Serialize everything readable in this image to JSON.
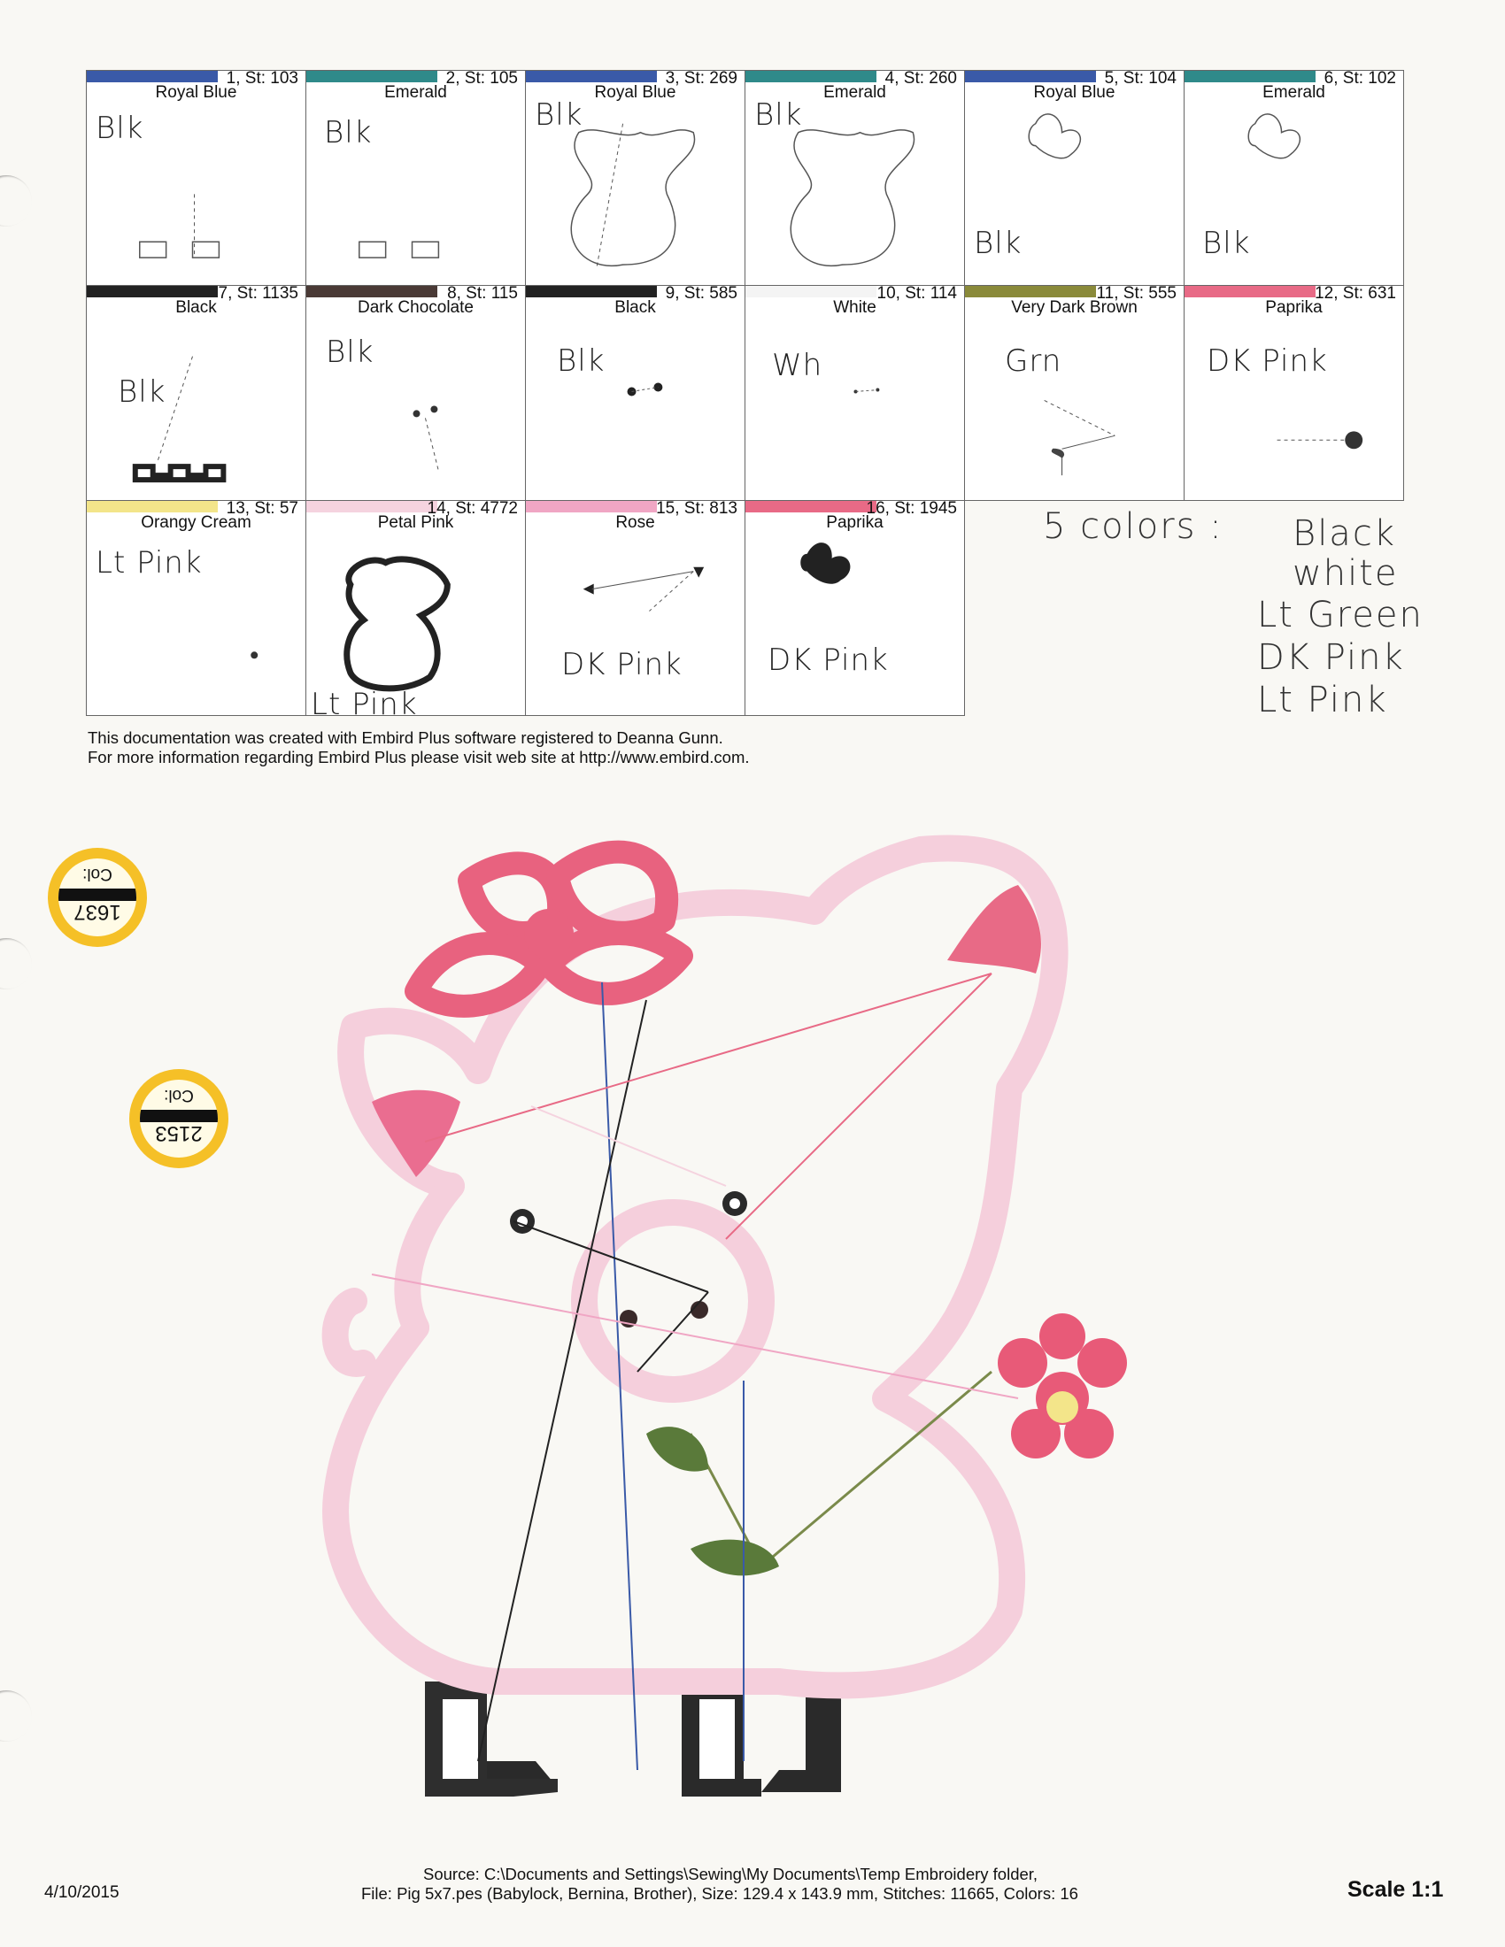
{
  "colors": {
    "royal_blue": "#3a5aa8",
    "emerald": "#2f8a8a",
    "black": "#222222",
    "dark_chocolate": "#4a3a36",
    "white": "#ffffff",
    "very_dark_brown": "#8a8a3a",
    "paprika": "#e86a86",
    "orangy_cream": "#f3e58a",
    "petal_pink": "#f5d3df",
    "rose": "#f0a6c4"
  },
  "swatches": [
    {
      "num": "1, St: 103",
      "name": "Royal Blue",
      "note": "Blk",
      "color": "royal_blue"
    },
    {
      "num": "2, St: 105",
      "name": "Emerald",
      "note": "Blk",
      "color": "emerald"
    },
    {
      "num": "3, St: 269",
      "name": "Royal Blue",
      "note": "Blk",
      "color": "royal_blue"
    },
    {
      "num": "4, St: 260",
      "name": "Emerald",
      "note": "Blk",
      "color": "emerald"
    },
    {
      "num": "5, St: 104",
      "name": "Royal Blue",
      "note": "Blk",
      "color": "royal_blue"
    },
    {
      "num": "6, St: 102",
      "name": "Emerald",
      "note": "Blk",
      "color": "emerald"
    },
    {
      "num": "7, St: 1135",
      "name": "Black",
      "note": "Blk",
      "color": "black"
    },
    {
      "num": "8, St: 115",
      "name": "Dark Chocolate",
      "note": "Blk",
      "color": "dark_chocolate"
    },
    {
      "num": "9, St: 585",
      "name": "Black",
      "note": "Blk",
      "color": "black"
    },
    {
      "num": "10, St: 114",
      "name": "White",
      "note": "Wh",
      "color": "white"
    },
    {
      "num": "11, St: 555",
      "name": "Very Dark Brown",
      "note": "Grn",
      "color": "very_dark_brown"
    },
    {
      "num": "12, St: 631",
      "name": "Paprika",
      "note": "DK Pink",
      "color": "paprika"
    },
    {
      "num": "13, St: 57",
      "name": "Orangy Cream",
      "note": "Lt Pink",
      "color": "orangy_cream"
    },
    {
      "num": "14, St: 4772",
      "name": "Petal Pink",
      "note": "Lt Pink",
      "color": "petal_pink"
    },
    {
      "num": "15, St: 813",
      "name": "Rose",
      "note": "DK Pink",
      "color": "rose"
    },
    {
      "num": "16, St: 1945",
      "name": "Paprika",
      "note": "DK Pink",
      "color": "paprika"
    }
  ],
  "handwritten_summary": {
    "heading": "5 colors :",
    "items": [
      "Black",
      "white",
      "Lt Green",
      "DK Pink",
      "Lt Pink"
    ]
  },
  "doc_note": {
    "line1": "This documentation was created with Embird Plus software registered to Deanna Gunn.",
    "line2": "For more information regarding Embird Plus please visit web site at http://www.embird.com."
  },
  "stickers": [
    {
      "label": "Col:",
      "code": "1637"
    },
    {
      "label": "Col:",
      "code": "2153"
    }
  ],
  "footer": {
    "date": "4/10/2015",
    "source": "Source: C:\\Documents and Settings\\Sewing\\My Documents\\Temp Embroidery folder,",
    "file": "File: Pig 5x7.pes (Babylock, Bernina, Brother), Size: 129.4 x 143.9 mm, Stitches: 11665, Colors: 16",
    "scale": "Scale 1:1"
  }
}
